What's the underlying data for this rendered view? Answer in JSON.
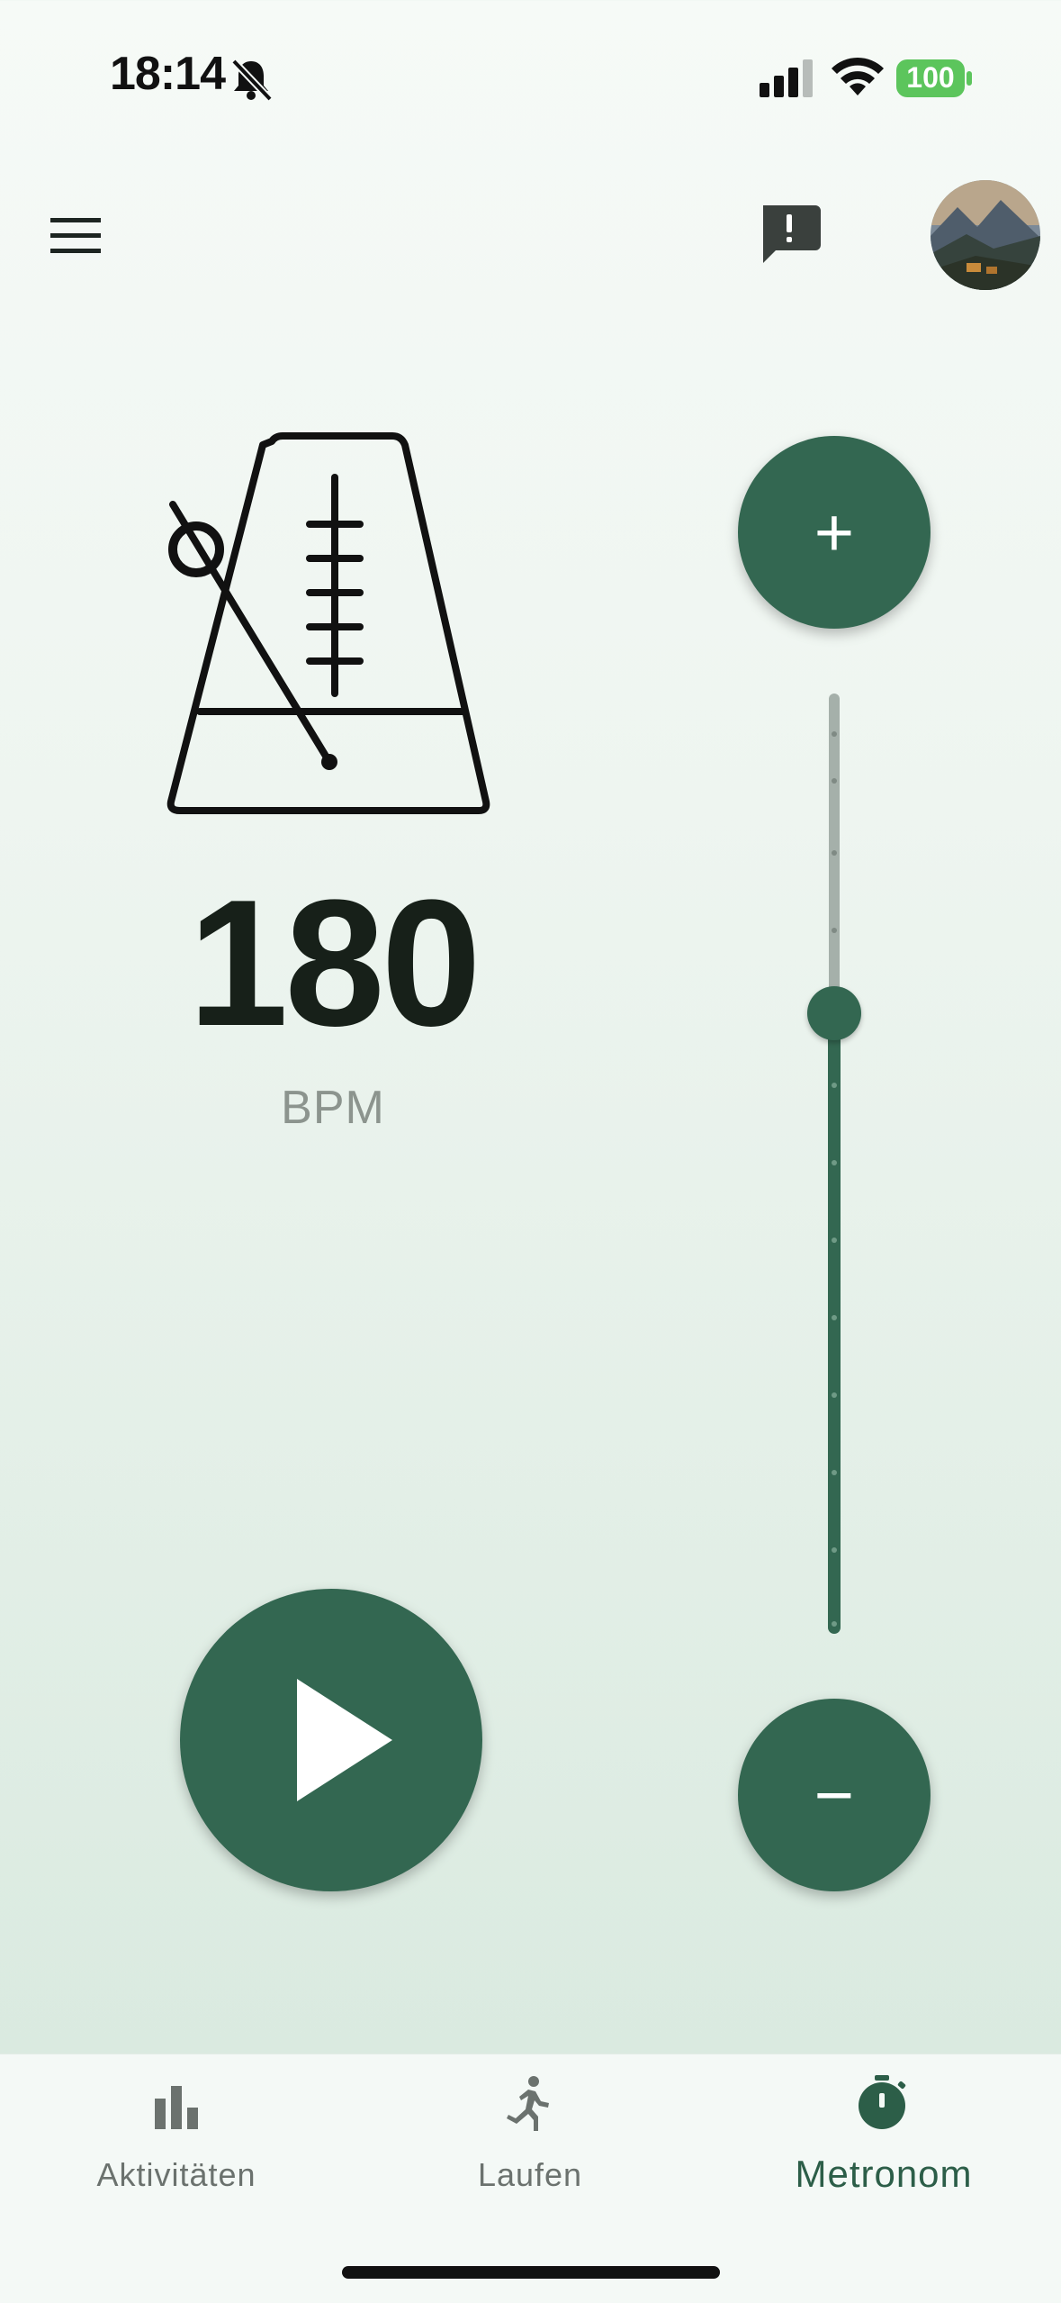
{
  "status_bar": {
    "time": "18:14",
    "battery": "100",
    "icons": [
      "bell-slash-icon",
      "signal-icon",
      "wifi-icon",
      "battery-icon"
    ]
  },
  "header": {
    "icons": [
      "menu-icon",
      "feedback-icon"
    ],
    "avatar_alt": "profile avatar"
  },
  "metronome": {
    "bpm": "180",
    "unit": "BPM",
    "slider_fraction": 0.66,
    "icons": [
      "metronome-icon",
      "plus-icon",
      "minus-icon",
      "play-icon"
    ],
    "plus_label": "+",
    "minus_label": "−"
  },
  "nav": {
    "items": [
      {
        "label": "Aktivitäten",
        "icon": "bar-chart-icon",
        "active": false
      },
      {
        "label": "Laufen",
        "icon": "runner-icon",
        "active": false
      },
      {
        "label": "Metronom",
        "icon": "stopwatch-icon",
        "active": true
      }
    ]
  },
  "colors": {
    "accent": "#336751",
    "track_inactive": "#a5b0aa",
    "text_dark": "#172019",
    "text_muted": "#8c948e"
  }
}
